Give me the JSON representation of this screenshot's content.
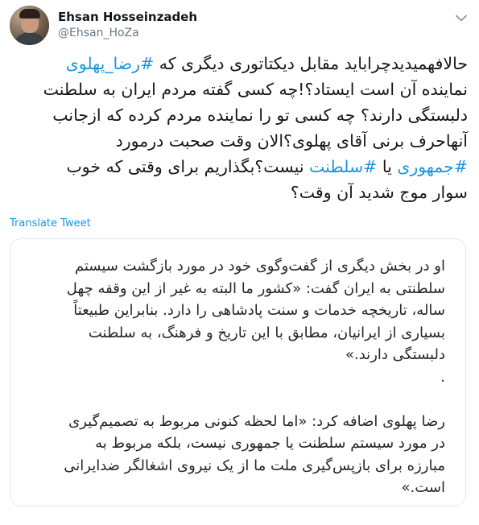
{
  "author": {
    "name": "Ehsan Hosseinzadeh",
    "handle": "@Ehsan_HoZa"
  },
  "tweet": {
    "lines": [
      [
        {
          "t": "حالافهمیدیدچراباید مقابل دیکتاتوری دیگری که ",
          "tag": false
        },
        {
          "t": "#رضا_پهلوی",
          "tag": true
        }
      ],
      [
        {
          "t": "نماینده آن است ایستاد؟!چه کسی گفته مردم ایران به سلطنت",
          "tag": false
        }
      ],
      [
        {
          "t": "دلبستگی دارند؟ چه کسی تو را نماینده مردم کرده که ازجانب",
          "tag": false
        }
      ],
      [
        {
          "t": "آنهاحرف برنی آقای پهلوی؟الان وقت صحبت درمورد",
          "tag": false
        }
      ],
      [
        {
          "t": "#جمهوری",
          "tag": true
        },
        {
          "t": " یا ",
          "tag": false
        },
        {
          "t": "#سلطنت",
          "tag": true
        },
        {
          "t": " نیست؟بگذاریم برای وقتی که خوب",
          "tag": false
        }
      ],
      [
        {
          "t": "سوار موج شدید آن وقت؟",
          "tag": false
        }
      ]
    ]
  },
  "translate_label": "Translate Tweet",
  "quote": {
    "lines": [
      "او در بخش دیگری از گفت‌وگوی خود در مورد بازگشت سیستم",
      "سلطنتی به ایران گفت: «کشور ما البته به غیر از این وقفه چهل",
      "ساله، تاریخچه خدمات و سنت پادشاهی را دارد. بنابراین طبیعتاً",
      "بسیاری از ایرانیان، مطابق با این تاریخ و فرهنگ، به سلطنت",
      "دلبستگی دارند.»",
      ".",
      "",
      "رضا پهلوی اضافه کرد: «اما لحظه کنونی مربوط به تصمیم‌گیری",
      "در مورد سیستم سلطنت یا جمهوری نیست، بلکه مربوط به",
      "مبارزه برای بازپس‌گیری ملت ما از یک نیروی اشغالگر ضدایرانی",
      "است.»"
    ]
  },
  "colors": {
    "link": "#1b95e0",
    "secondary_text": "#657786",
    "border": "#e1e8ed"
  },
  "icons": {
    "menu": "chevron-down-icon",
    "avatar": "profile-photo"
  }
}
